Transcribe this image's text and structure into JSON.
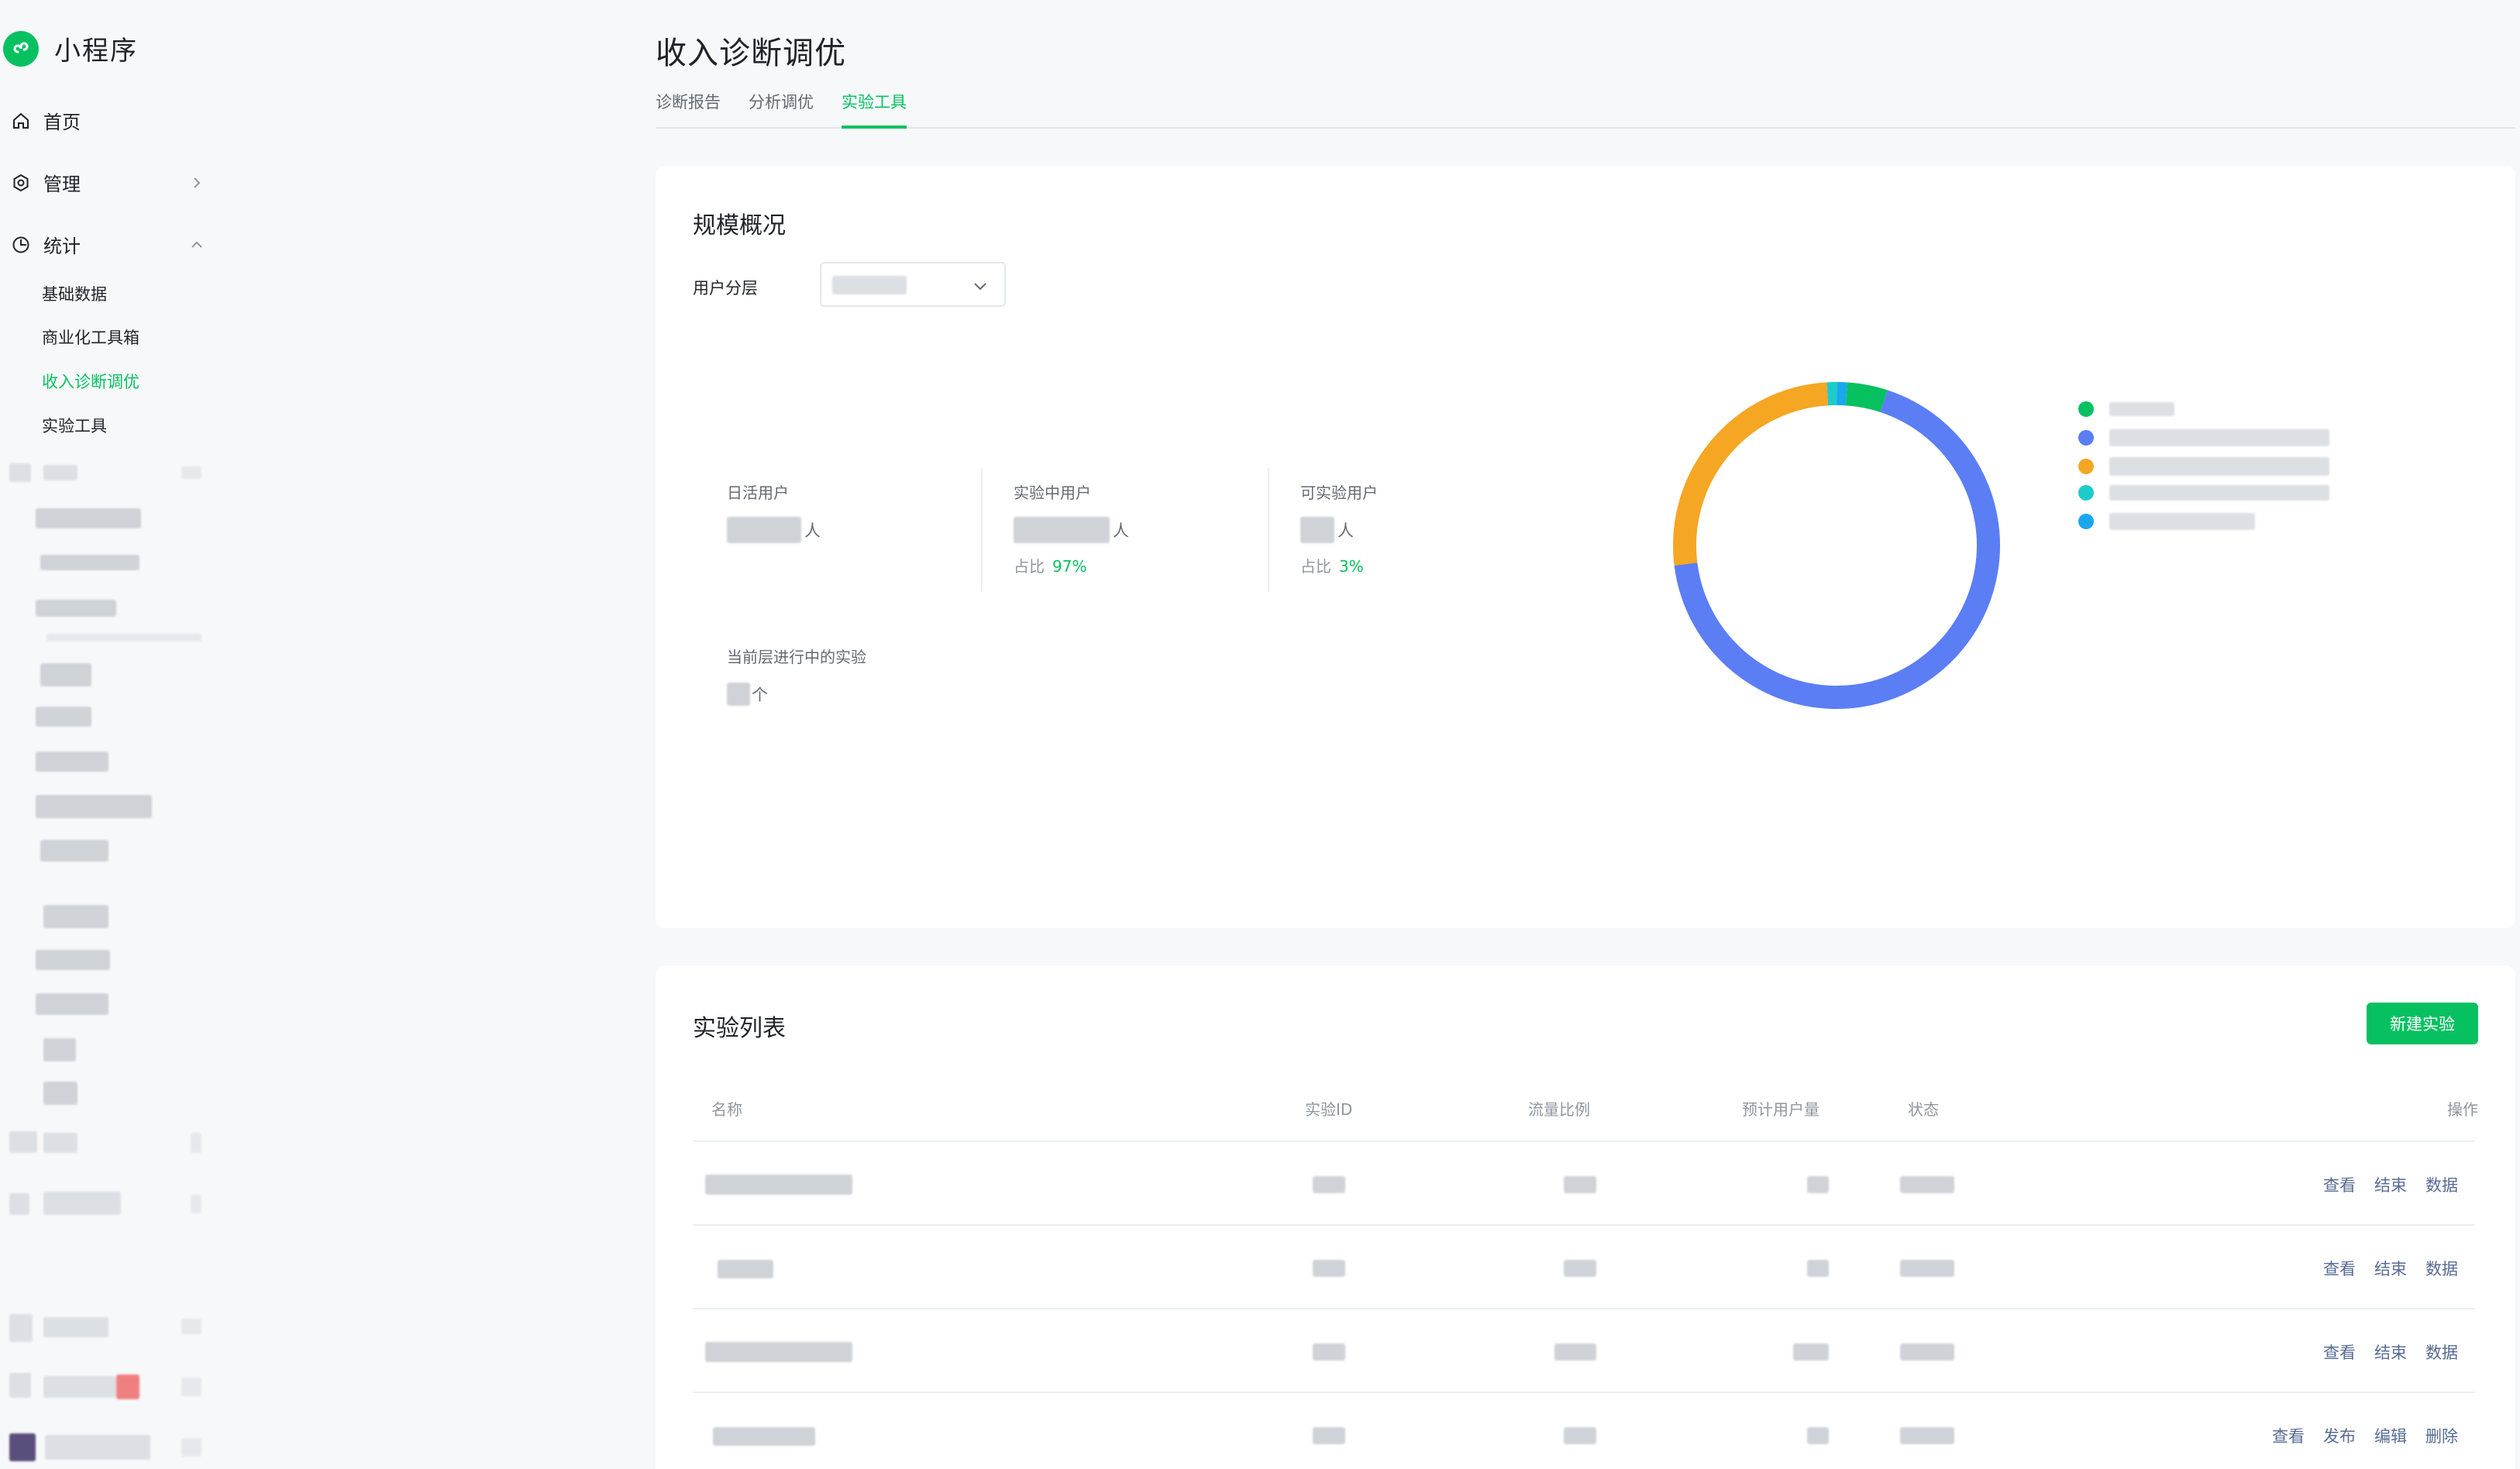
{
  "app": {
    "name": "小程序",
    "accent": "#07c160",
    "link_color": "#576b95"
  },
  "sidebar": {
    "items": [
      {
        "label": "首页",
        "icon": "home-icon"
      },
      {
        "label": "管理",
        "icon": "gear-icon",
        "chevron": "chevron-right-icon"
      },
      {
        "label": "统计",
        "icon": "clock-chart-icon",
        "chevron": "chevron-up-icon"
      }
    ],
    "sub_items": [
      {
        "label": "基础数据",
        "active": false
      },
      {
        "label": "商业化工具箱",
        "active": false
      },
      {
        "label": "收入诊断调优",
        "active": true
      },
      {
        "label": "实验工具",
        "active": false
      }
    ]
  },
  "page": {
    "title": "收入诊断调优",
    "tabs": [
      {
        "label": "诊断报告",
        "active": false
      },
      {
        "label": "分析调优",
        "active": false
      },
      {
        "label": "实验工具",
        "active": true
      }
    ]
  },
  "overview": {
    "title": "规模概况",
    "filter_label": "用户分层",
    "stats": [
      {
        "label": "日活用户",
        "unit": "人"
      },
      {
        "label": "实验中用户",
        "unit": "人",
        "share_label": "占比",
        "share": "97%"
      },
      {
        "label": "可实验用户",
        "unit": "人",
        "share_label": "占比",
        "share": "3%"
      }
    ],
    "running": {
      "label": "当前层进行中的实验",
      "unit": "个"
    },
    "donut_colors": [
      "#07c160",
      "#5b7ef5",
      "#f5a623",
      "#1ecbcb",
      "#1aa7ee"
    ],
    "donut_shares": [
      0.04,
      0.68,
      0.26,
      0.01,
      0.01
    ]
  },
  "experiments": {
    "title": "实验列表",
    "new_button": "新建实验",
    "columns": [
      "名称",
      "实验ID",
      "流量比例",
      "预计用户量",
      "状态",
      "操作"
    ],
    "rows": [
      {
        "actions": [
          "查看",
          "结束",
          "数据"
        ]
      },
      {
        "actions": [
          "查看",
          "结束",
          "数据"
        ]
      },
      {
        "actions": [
          "查看",
          "结束",
          "数据"
        ]
      },
      {
        "actions": [
          "查看",
          "发布",
          "编辑",
          "删除"
        ]
      }
    ]
  }
}
